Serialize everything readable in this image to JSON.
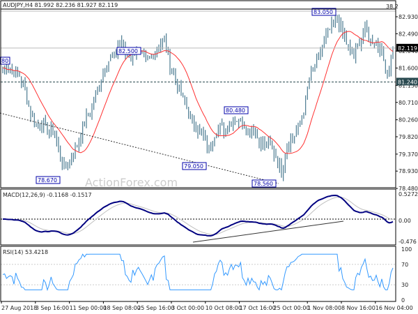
{
  "chart_data": {
    "type": "ohlc-bar",
    "title": "AUDJPY,H4",
    "ohlc_readout": "81.992 82.236 81.927 82.119",
    "header": "AUDJPY,H4  81.992 82.236 81.927 82.119",
    "price_ticks": [
      "82.930",
      "82.490",
      "82.040",
      "81.600",
      "81.150",
      "80.710",
      "80.260",
      "79.820",
      "79.370",
      "78.930",
      "78.480"
    ],
    "ylim": [
      78.48,
      83.1
    ],
    "current_price": "82.119",
    "support_level": "81.240",
    "fib_label": "38.2",
    "annotations": [
      "80",
      "82.500",
      "78.670",
      "79.050",
      "80.480",
      "78.560",
      "83.050"
    ],
    "x_ticks": [
      "27 Aug 2018",
      "3 Sep 16:00",
      "11 Sep 00:00",
      "18 Sep 08:00",
      "25 Sep 16:00",
      "3 Oct 00:00",
      "10 Oct 08:00",
      "17 Oct 16:00",
      "25 Oct 00:00",
      "1 Nov 08:00",
      "8 Nov 16:00",
      "16 Nov 04:00"
    ],
    "closes_approx": [
      81.6,
      81.6,
      81.5,
      81.4,
      81.0,
      80.4,
      80.1,
      80.2,
      80.0,
      80.0,
      79.5,
      79.0,
      79.2,
      79.5,
      79.9,
      80.3,
      80.6,
      81.0,
      81.5,
      81.8,
      81.9,
      82.3,
      82.0,
      81.9,
      82.1,
      81.9,
      81.8,
      82.0,
      82.2,
      82.3,
      81.7,
      81.3,
      80.9,
      80.6,
      80.2,
      80.0,
      79.8,
      79.5,
      79.9,
      80.1,
      80.0,
      80.2,
      80.3,
      80.2,
      80.0,
      80.0,
      79.7,
      79.6,
      79.6,
      79.3,
      78.9,
      79.6,
      79.8,
      80.0,
      80.5,
      81.3,
      81.7,
      82.0,
      82.4,
      82.7,
      82.9,
      82.5,
      82.1,
      81.9,
      82.3,
      82.6,
      82.3,
      82.3,
      82.0,
      81.4,
      82.1
    ],
    "macd": {
      "label": "MACD(12,26,9) -0.1168 -0.1517",
      "ticks": [
        "0.5272",
        "0.00",
        "-0.476"
      ],
      "ylim": [
        -0.476,
        0.5272
      ]
    },
    "rsi": {
      "label": "RSI(14) 53.4218",
      "ticks": [
        "100",
        "70",
        "30",
        "0"
      ],
      "ylim": [
        0,
        100
      ]
    },
    "colors": {
      "bars": "#4a7a90",
      "ma": "#ff3030",
      "macd": "#000080",
      "signal": "#c0c0c0",
      "rsi": "#3399ff",
      "label_box": "#0000aa"
    }
  },
  "watermark": "ActionForex.com"
}
